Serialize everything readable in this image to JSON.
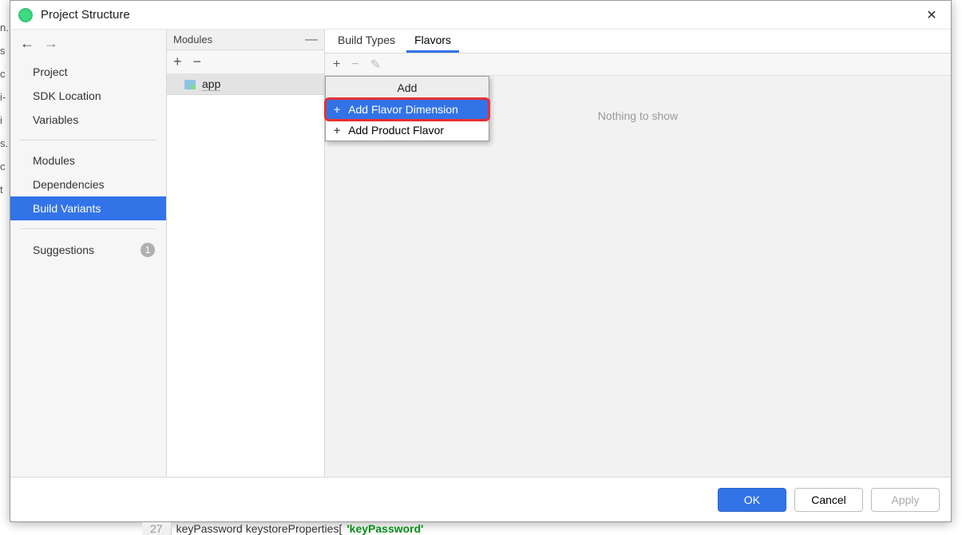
{
  "dialog": {
    "title": "Project Structure"
  },
  "sidebar": {
    "items": [
      {
        "label": "Project"
      },
      {
        "label": "SDK Location"
      },
      {
        "label": "Variables"
      },
      {
        "label": "Modules"
      },
      {
        "label": "Dependencies"
      },
      {
        "label": "Build Variants"
      },
      {
        "label": "Suggestions",
        "badge": "1"
      }
    ]
  },
  "modules": {
    "header": "Modules",
    "items": [
      {
        "label": "app"
      }
    ]
  },
  "tabs": [
    {
      "label": "Build Types"
    },
    {
      "label": "Flavors"
    }
  ],
  "popup": {
    "header": "Add",
    "items": [
      {
        "label": "Add Flavor Dimension"
      },
      {
        "label": "Add Product Flavor"
      }
    ]
  },
  "empty": "Nothing to show",
  "footer": {
    "ok": "OK",
    "cancel": "Cancel",
    "apply": "Apply"
  },
  "bgcode": {
    "snippet_prefix": "keyPassword keystoreProperties[",
    "snippet_str": "'keyPassword'"
  }
}
